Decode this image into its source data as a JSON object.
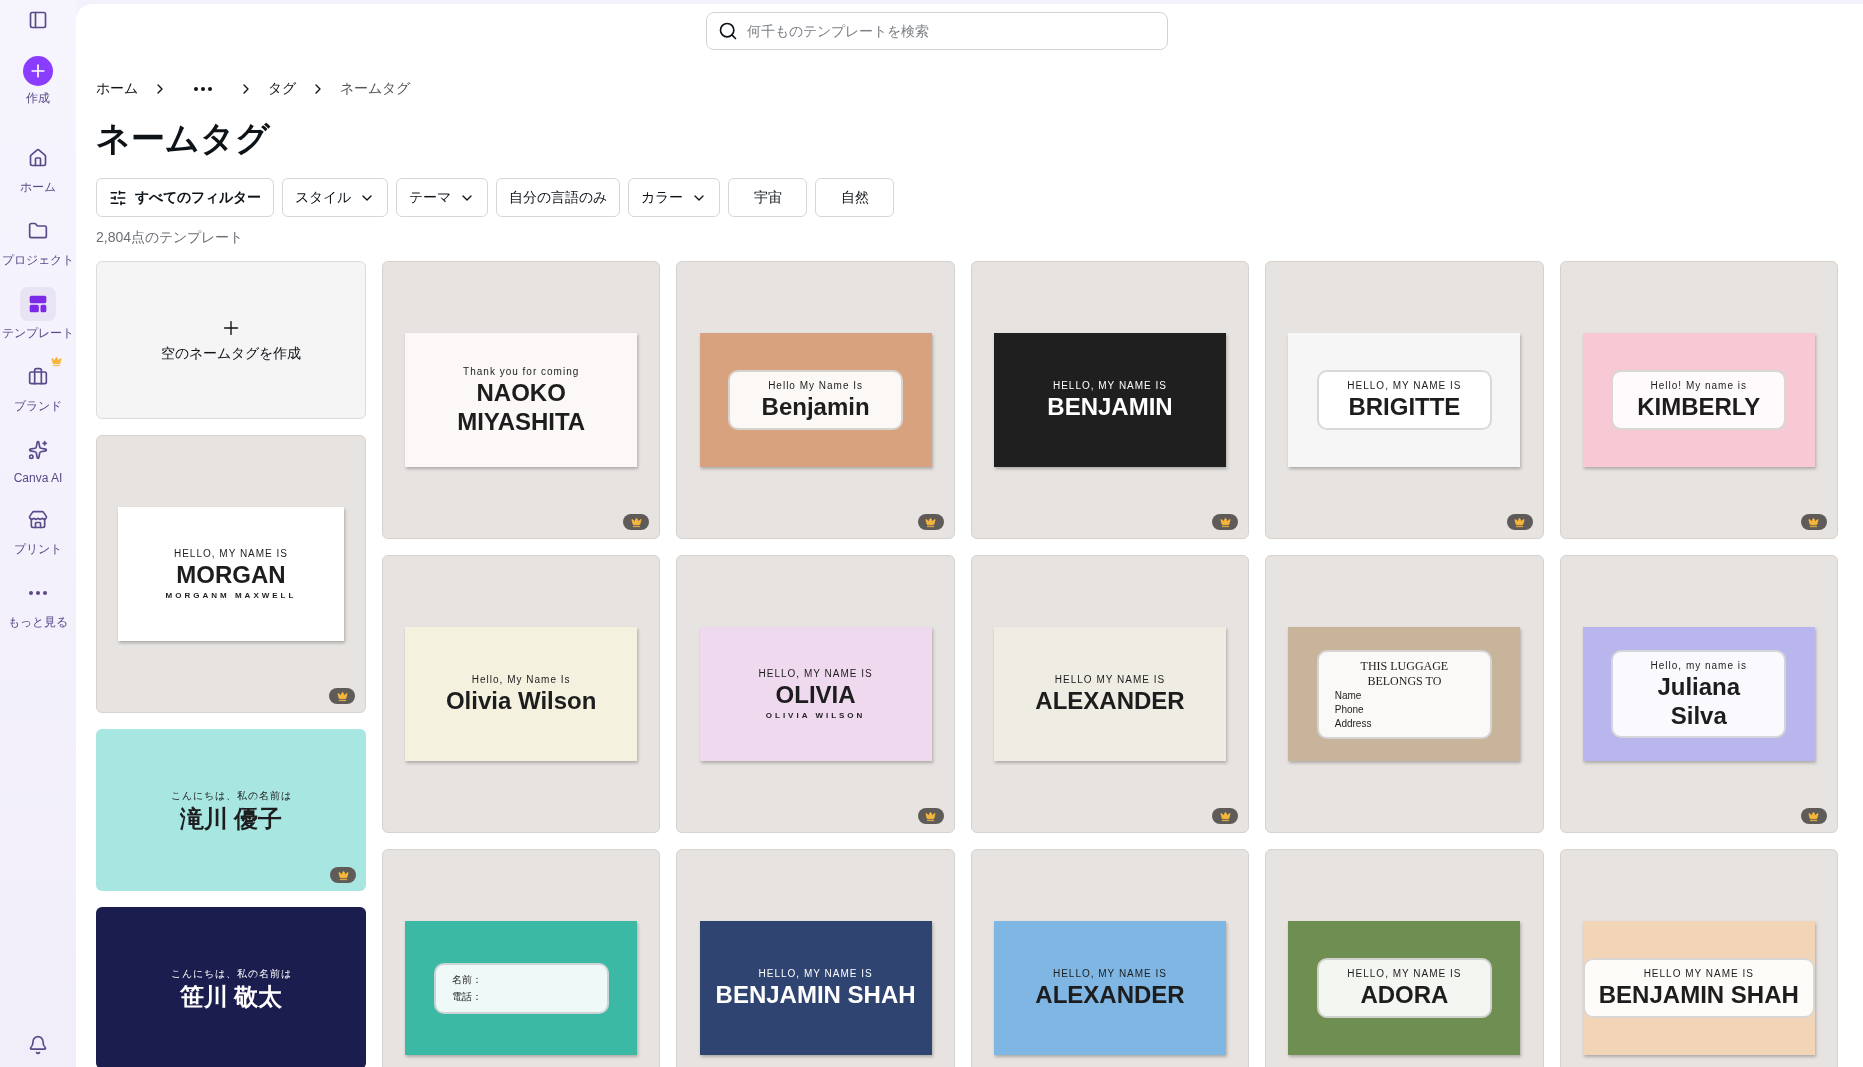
{
  "search": {
    "placeholder": "何千ものテンプレートを検索"
  },
  "sidebar": {
    "create": {
      "label": "作成"
    },
    "items": [
      {
        "kind": "home",
        "label": "ホーム",
        "selected": false,
        "premium": false
      },
      {
        "kind": "folder",
        "label": "プロジェクト",
        "selected": false,
        "premium": false
      },
      {
        "kind": "template",
        "label": "テンプレート",
        "selected": true,
        "premium": false
      },
      {
        "kind": "brand",
        "label": "ブランド",
        "selected": false,
        "premium": true
      },
      {
        "kind": "ai",
        "label": "Canva AI",
        "selected": false,
        "premium": false
      },
      {
        "kind": "print",
        "label": "プリント",
        "selected": false,
        "premium": false
      },
      {
        "kind": "more",
        "label": "もっと見る",
        "selected": false,
        "premium": false
      }
    ]
  },
  "breadcrumb": [
    {
      "kind": "link",
      "label": "ホーム"
    },
    {
      "kind": "more"
    },
    {
      "kind": "link",
      "label": "タグ"
    },
    {
      "kind": "current",
      "label": "ネームタグ"
    }
  ],
  "title": "ネームタグ",
  "filters": [
    {
      "label": "すべてのフィルター",
      "kind": "all"
    },
    {
      "label": "スタイル",
      "kind": "dropdown"
    },
    {
      "label": "テーマ",
      "kind": "dropdown"
    },
    {
      "label": "自分の言語のみ",
      "kind": "chip"
    },
    {
      "label": "カラー",
      "kind": "dropdown"
    },
    {
      "label": "宇宙",
      "kind": "chip"
    },
    {
      "label": "自然",
      "kind": "chip"
    }
  ],
  "count": "2,804点のテンプレート",
  "first_column": [
    {
      "kind": "blank",
      "label": "空のネームタグを作成"
    },
    {
      "kind": "plain",
      "color": "#ffffff",
      "premium": true,
      "lines": [
        {
          "kind": "greeting",
          "text": "HELLO, MY NAME IS"
        },
        {
          "kind": "name",
          "text": "MORGAN"
        },
        {
          "kind": "subname",
          "text": "MORGANM MAXWELL"
        }
      ]
    },
    {
      "kind": "full",
      "color": "#a8e6e2",
      "premium": true,
      "lines": [
        {
          "kind": "greeting",
          "text": "こんにちは、私の名前は"
        },
        {
          "kind": "name",
          "text": "滝川 優子"
        }
      ]
    },
    {
      "kind": "full",
      "color": "#1c1d4f",
      "premium": false,
      "lines": [
        {
          "kind": "greeting",
          "text": "こんにちは、私の名前は"
        },
        {
          "kind": "name",
          "text": "笹川 敬太"
        }
      ]
    }
  ],
  "templates": [
    {
      "kind": "plain",
      "color": "#fbf8f7",
      "premium": true,
      "lines": [
        {
          "kind": "greeting",
          "text": "Thank you for coming"
        },
        {
          "kind": "name",
          "text": "NAOKO"
        },
        {
          "kind": "name",
          "text": "MIYASHITA"
        }
      ]
    },
    {
      "kind": "framed",
      "color": "#d9a27e",
      "premium": true,
      "lines": [
        {
          "kind": "greeting",
          "text": "Hello My Name Is"
        },
        {
          "kind": "name",
          "text": "Benjamin"
        }
      ]
    },
    {
      "kind": "plain",
      "color": "#1f1f1f",
      "premium": true,
      "lines": [
        {
          "kind": "greeting",
          "text": "HELLO, MY NAME IS"
        },
        {
          "kind": "name",
          "text": "BENJAMIN"
        }
      ]
    },
    {
      "kind": "framed",
      "color": "#f6f6f6",
      "premium": true,
      "lines": [
        {
          "kind": "greeting",
          "text": "HELLO, MY NAME IS"
        },
        {
          "kind": "name",
          "text": "BRIGITTE"
        }
      ]
    },
    {
      "kind": "framed",
      "color": "#f7c9d4",
      "premium": true,
      "lines": [
        {
          "kind": "greeting",
          "text": "Hello! My name is"
        },
        {
          "kind": "name",
          "text": "KIMBERLY"
        }
      ]
    },
    {
      "kind": "plain",
      "color": "#f4f1df",
      "premium": false,
      "lines": [
        {
          "kind": "greeting",
          "text": "Hello, My Name Is"
        },
        {
          "kind": "name",
          "text": "Olivia Wilson"
        }
      ]
    },
    {
      "kind": "plain",
      "color": "#efd9ef",
      "premium": true,
      "lines": [
        {
          "kind": "greeting",
          "text": "HELLO, MY NAME IS"
        },
        {
          "kind": "name",
          "text": "OLIVIA"
        },
        {
          "kind": "subname",
          "text": "OLIVIA WILSON"
        }
      ]
    },
    {
      "kind": "plain",
      "color": "#efece4",
      "premium": true,
      "lines": [
        {
          "kind": "greeting",
          "text": "HELLO MY NAME IS"
        },
        {
          "kind": "name",
          "text": "ALEXANDER"
        }
      ]
    },
    {
      "kind": "framed",
      "color": "#c8b49a",
      "premium": false,
      "lines": [
        {
          "kind": "heading",
          "text": "THIS LUGGAGE"
        },
        {
          "kind": "heading",
          "text": "BELONGS TO"
        },
        {
          "kind": "field",
          "text": "Name"
        },
        {
          "kind": "field",
          "text": "Phone"
        },
        {
          "kind": "field",
          "text": "Address"
        }
      ]
    },
    {
      "kind": "framed",
      "color": "#b9b6ee",
      "premium": true,
      "lines": [
        {
          "kind": "greeting",
          "text": "Hello, my name is"
        },
        {
          "kind": "name",
          "text": "Juliana"
        },
        {
          "kind": "name",
          "text": "Silva"
        }
      ]
    },
    {
      "kind": "framed",
      "color": "#3cb9a4",
      "premium": false,
      "lines": [
        {
          "kind": "field",
          "text": "名前："
        },
        {
          "kind": "field",
          "text": "電話："
        }
      ]
    },
    {
      "kind": "plain",
      "color": "#2f4470",
      "premium": false,
      "lines": [
        {
          "kind": "greeting",
          "text": "HELLO, MY NAME IS"
        },
        {
          "kind": "name",
          "text": "BENJAMIN SHAH"
        }
      ]
    },
    {
      "kind": "plain",
      "color": "#7fb6e4",
      "premium": false,
      "lines": [
        {
          "kind": "greeting",
          "text": "HELLO, MY NAME IS"
        },
        {
          "kind": "name",
          "text": "ALEXANDER"
        }
      ]
    },
    {
      "kind": "framed",
      "color": "#6f8f52",
      "premium": false,
      "lines": [
        {
          "kind": "greeting",
          "text": "HELLO, MY NAME IS"
        },
        {
          "kind": "name",
          "text": "ADORA"
        }
      ]
    },
    {
      "kind": "framed",
      "color": "#f2d4b6",
      "premium": false,
      "lines": [
        {
          "kind": "greeting",
          "text": "HELLO MY NAME IS"
        },
        {
          "kind": "name",
          "text": "BENJAMIN SHAH"
        }
      ]
    }
  ]
}
